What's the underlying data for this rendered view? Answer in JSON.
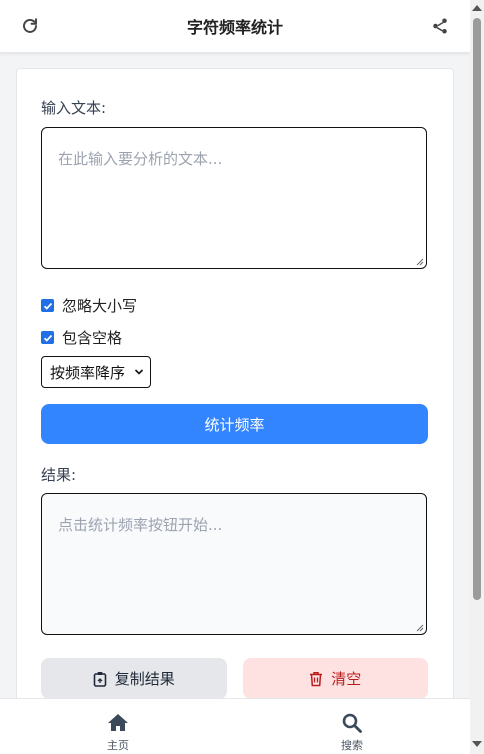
{
  "header": {
    "title": "字符频率统计",
    "left_icon": "refresh-icon",
    "right_icon": "share-icon"
  },
  "input": {
    "label": "输入文本:",
    "placeholder": "在此输入要分析的文本..."
  },
  "options": {
    "ignore_case": {
      "label": "忽略大小写",
      "checked": true
    },
    "include_spaces": {
      "label": "包含空格",
      "checked": true
    },
    "sort": {
      "selected": "按频率降序"
    }
  },
  "actions": {
    "count_label": "统计频率",
    "copy_label": "复制结果",
    "clear_label": "清空"
  },
  "result": {
    "label": "结果:",
    "placeholder": "点击统计频率按钮开始..."
  },
  "nav": {
    "home_label": "主页",
    "search_label": "搜索"
  },
  "colors": {
    "primary": "#3385ff",
    "danger_bg": "#fee2e2",
    "danger_text": "#b91c1c"
  }
}
